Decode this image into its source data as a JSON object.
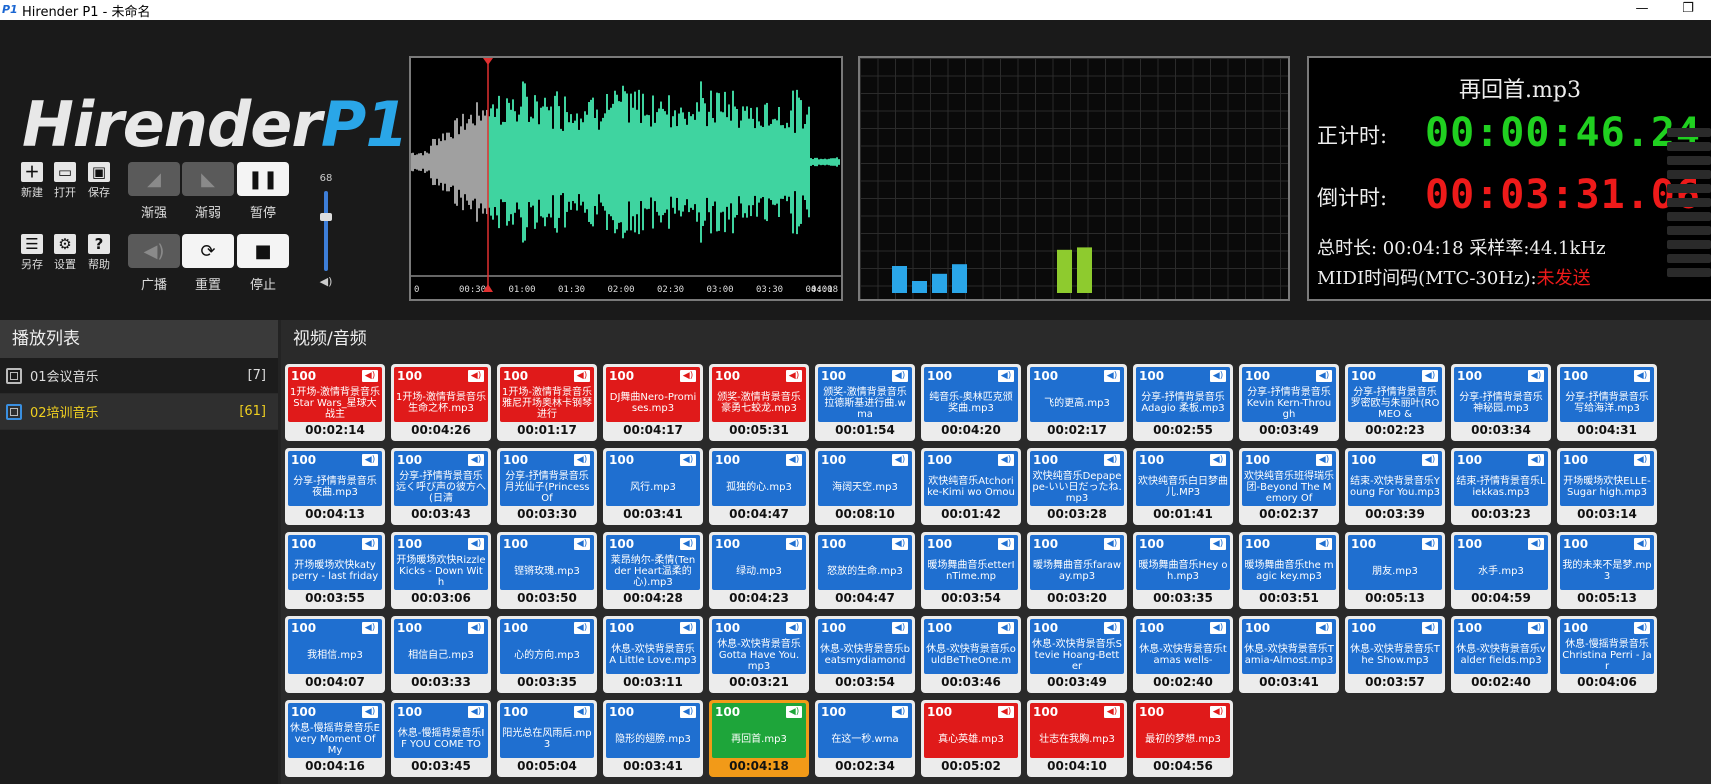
{
  "window": {
    "title": "Hirender P1 - 未命名",
    "minimize": "—",
    "maximize": "❐"
  },
  "logo": {
    "text_white": "Hirender",
    "text_blue": "P1"
  },
  "toolbar": {
    "new_label": "新建",
    "open_label": "打开",
    "save_label": "保存",
    "saveas_label": "另存",
    "settings_label": "设置",
    "help_label": "帮助",
    "fade_in_label": "渐强",
    "fade_out_label": "渐弱",
    "pause_label": "暂停",
    "broadcast_label": "广播",
    "reset_label": "重置",
    "stop_label": "停止"
  },
  "volume": {
    "value": "68",
    "level_fraction": 0.68
  },
  "waveform": {
    "ticks": [
      "0",
      "00:30",
      "01:00",
      "01:30",
      "02:00",
      "02:30",
      "03:00",
      "03:30",
      "04:00",
      "04:18"
    ],
    "played_color": "#a0a0a0",
    "remaining_color": "#3fd4a0",
    "playhead_color": "#e03030",
    "position_fraction": 0.18
  },
  "spectrum": {
    "bars_left_color": "#2aa6e8",
    "bars_right_color": "#8ecb2e",
    "bars_left": [
      0.45,
      0.2,
      0.32,
      0.48
    ],
    "bars_right": [
      0.72,
      0.76
    ]
  },
  "timer": {
    "filename": "再回首.mp3",
    "elapsed_label": "正计时:",
    "elapsed_value": "00:00:46.24",
    "elapsed_color": "#20d020",
    "remaining_label": "倒计时:",
    "remaining_value": "00:03:31.06",
    "remaining_color": "#ee1a1a",
    "total_line": "总时长: 00:04:18  采样率:44.1kHz",
    "midi_label": "MIDI时间码(MTC-30Hz):",
    "midi_status": "未发送"
  },
  "playlist": {
    "header": "播放列表",
    "items": [
      {
        "name": "01会议音乐",
        "count": "[7]"
      },
      {
        "name": "02培训音乐",
        "count": "[61]"
      }
    ]
  },
  "media": {
    "header": "视频/音频",
    "tiles": [
      {
        "color": "red",
        "volume": "100",
        "name": "1开场-激情背景音乐Star Wars_星球大战主",
        "duration": "00:02:14"
      },
      {
        "color": "red",
        "volume": "100",
        "name": "1开场-激情背景音乐生命之杯.mp3",
        "duration": "00:04:26"
      },
      {
        "color": "red",
        "volume": "100",
        "name": "1开场-激情背景音乐雅尼开场奥林卡钢琴进行",
        "duration": "00:01:17"
      },
      {
        "color": "red",
        "volume": "100",
        "name": "DJ舞曲Nero-Promises.mp3",
        "duration": "00:04:17"
      },
      {
        "color": "red",
        "volume": "100",
        "name": "颁奖-激情背景音乐豪勇七蛟龙.mp3",
        "duration": "00:05:31"
      },
      {
        "color": "blue",
        "volume": "100",
        "name": "颁奖-激情背景音乐拉德斯基进行曲.wma",
        "duration": "00:01:54"
      },
      {
        "color": "blue",
        "volume": "100",
        "name": "纯音乐-奥林匹克颁奖曲.mp3",
        "duration": "00:04:20"
      },
      {
        "color": "blue",
        "volume": "100",
        "name": "飞的更高.mp3",
        "duration": "00:02:17"
      },
      {
        "color": "blue",
        "volume": "100",
        "name": "分享-抒情背景音乐Adagio 柔板.mp3",
        "duration": "00:02:55"
      },
      {
        "color": "blue",
        "volume": "100",
        "name": "分享-抒情背景音乐Kevin Kern-Through",
        "duration": "00:03:49"
      },
      {
        "color": "blue",
        "volume": "100",
        "name": "分享-抒情背景音乐罗密欧与朱丽叶(ROMEO &",
        "duration": "00:02:23"
      },
      {
        "color": "blue",
        "volume": "100",
        "name": "分享-抒情背景音乐神秘园.mp3",
        "duration": "00:03:34"
      },
      {
        "color": "blue",
        "volume": "100",
        "name": "分享-抒情背景音乐写给海洋.mp3",
        "duration": "00:04:31"
      },
      {
        "color": "blue",
        "volume": "100",
        "name": "分享-抒情背景音乐夜曲.mp3",
        "duration": "00:04:13"
      },
      {
        "color": "blue",
        "volume": "100",
        "name": "分享-抒情背景音乐远く呼び声の彼方へ(日清",
        "duration": "00:03:43"
      },
      {
        "color": "blue",
        "volume": "100",
        "name": "分享-抒情背景音乐月光仙子(Princess Of",
        "duration": "00:03:30"
      },
      {
        "color": "blue",
        "volume": "100",
        "name": "风行.mp3",
        "duration": "00:03:41"
      },
      {
        "color": "blue",
        "volume": "100",
        "name": "孤独的心.mp3",
        "duration": "00:04:47"
      },
      {
        "color": "blue",
        "volume": "100",
        "name": "海阔天空.mp3",
        "duration": "00:08:10"
      },
      {
        "color": "blue",
        "volume": "100",
        "name": "欢快纯音乐Atchorike-Kimi wo Omou",
        "duration": "00:01:42"
      },
      {
        "color": "blue",
        "volume": "100",
        "name": "欢快纯音乐Depapepe-いい日だったね.mp3",
        "duration": "00:03:28"
      },
      {
        "color": "blue",
        "volume": "100",
        "name": "欢快纯音乐白日梦曲儿.MP3",
        "duration": "00:01:41"
      },
      {
        "color": "blue",
        "volume": "100",
        "name": "欢快纯音乐班得瑞乐团-Beyond The Memory Of",
        "duration": "00:02:37"
      },
      {
        "color": "blue",
        "volume": "100",
        "name": "结束-欢快背景音乐Young For You.mp3",
        "duration": "00:03:39"
      },
      {
        "color": "blue",
        "volume": "100",
        "name": "结束-抒情背景音乐Liekkas.mp3",
        "duration": "00:03:23"
      },
      {
        "color": "blue",
        "volume": "100",
        "name": "开场暖场欢快ELLE-Sugar high.mp3",
        "duration": "00:03:14"
      },
      {
        "color": "blue",
        "volume": "100",
        "name": "开场暖场欢快katy perry - last friday",
        "duration": "00:03:55"
      },
      {
        "color": "blue",
        "volume": "100",
        "name": "开场暖场欢快Rizzle Kicks - Down With",
        "duration": "00:03:06"
      },
      {
        "color": "blue",
        "volume": "100",
        "name": "铿锵玫瑰.mp3",
        "duration": "00:03:50"
      },
      {
        "color": "blue",
        "volume": "100",
        "name": "莱昂纳尔-柔情(Tender Heart温柔的心).mp3",
        "duration": "00:04:28"
      },
      {
        "color": "blue",
        "volume": "100",
        "name": "绿动.mp3",
        "duration": "00:04:23"
      },
      {
        "color": "blue",
        "volume": "100",
        "name": "怒放的生命.mp3",
        "duration": "00:04:47"
      },
      {
        "color": "blue",
        "volume": "100",
        "name": "暖场舞曲音乐etterInTime.mp",
        "duration": "00:03:54"
      },
      {
        "color": "blue",
        "volume": "100",
        "name": "暖场舞曲音乐faraway.mp3",
        "duration": "00:03:20"
      },
      {
        "color": "blue",
        "volume": "100",
        "name": "暖场舞曲音乐Hey oh.mp3",
        "duration": "00:03:35"
      },
      {
        "color": "blue",
        "volume": "100",
        "name": "暖场舞曲音乐the magic key.mp3",
        "duration": "00:03:51"
      },
      {
        "color": "blue",
        "volume": "100",
        "name": "朋友.mp3",
        "duration": "00:05:13"
      },
      {
        "color": "blue",
        "volume": "100",
        "name": "水手.mp3",
        "duration": "00:04:59"
      },
      {
        "color": "blue",
        "volume": "100",
        "name": "我的未来不是梦.mp3",
        "duration": "00:05:13"
      },
      {
        "color": "blue",
        "volume": "100",
        "name": "我相信.mp3",
        "duration": "00:04:07"
      },
      {
        "color": "blue",
        "volume": "100",
        "name": "相信自己.mp3",
        "duration": "00:03:33"
      },
      {
        "color": "blue",
        "volume": "100",
        "name": "心的方向.mp3",
        "duration": "00:03:35"
      },
      {
        "color": "blue",
        "volume": "100",
        "name": "休息-欢快背景音乐A Little Love.mp3",
        "duration": "00:03:11"
      },
      {
        "color": "blue",
        "volume": "100",
        "name": "休息-欢快背景音乐Gotta Have You.mp3",
        "duration": "00:03:21"
      },
      {
        "color": "blue",
        "volume": "100",
        "name": "休息-欢快背景音乐beatsmydiamond",
        "duration": "00:03:54"
      },
      {
        "color": "blue",
        "volume": "100",
        "name": "休息-欢快背景音乐ouldBeTheOne.m",
        "duration": "00:03:46"
      },
      {
        "color": "blue",
        "volume": "100",
        "name": "休息-欢快背景音乐Stevie Hoang-Better",
        "duration": "00:03:49"
      },
      {
        "color": "blue",
        "volume": "100",
        "name": "休息-欢快背景音乐tamas wells-",
        "duration": "00:02:40"
      },
      {
        "color": "blue",
        "volume": "100",
        "name": "休息-欢快背景音乐Tamia-Almost.mp3",
        "duration": "00:03:41"
      },
      {
        "color": "blue",
        "volume": "100",
        "name": "休息-欢快背景音乐The Show.mp3",
        "duration": "00:03:57"
      },
      {
        "color": "blue",
        "volume": "100",
        "name": "休息-欢快背景音乐valder fields.mp3",
        "duration": "00:02:40"
      },
      {
        "color": "blue",
        "volume": "100",
        "name": "休息-慢摇背景音乐Christina Perri - Jar",
        "duration": "00:04:06"
      },
      {
        "color": "blue",
        "volume": "100",
        "name": "休息-慢摇背景音乐Every Moment Of My",
        "duration": "00:04:16"
      },
      {
        "color": "blue",
        "volume": "100",
        "name": "休息-慢摇背景音乐IF YOU COME TO",
        "duration": "00:03:45"
      },
      {
        "color": "blue",
        "volume": "100",
        "name": "阳光总在风雨后.mp3",
        "duration": "00:05:04"
      },
      {
        "color": "blue",
        "volume": "100",
        "name": "隐形的翅膀.mp3",
        "duration": "00:03:41"
      },
      {
        "color": "green",
        "volume": "100",
        "name": "再回首.mp3",
        "duration": "00:04:18",
        "active": true
      },
      {
        "color": "blue",
        "volume": "100",
        "name": "在这一秒.wma",
        "duration": "00:02:34"
      },
      {
        "color": "red",
        "volume": "100",
        "name": "真心英雄.mp3",
        "duration": "00:05:02"
      },
      {
        "color": "red",
        "volume": "100",
        "name": "壮志在我胸.mp3",
        "duration": "00:04:10"
      },
      {
        "color": "red",
        "volume": "100",
        "name": "最初的梦想.mp3",
        "duration": "00:04:56"
      }
    ]
  }
}
